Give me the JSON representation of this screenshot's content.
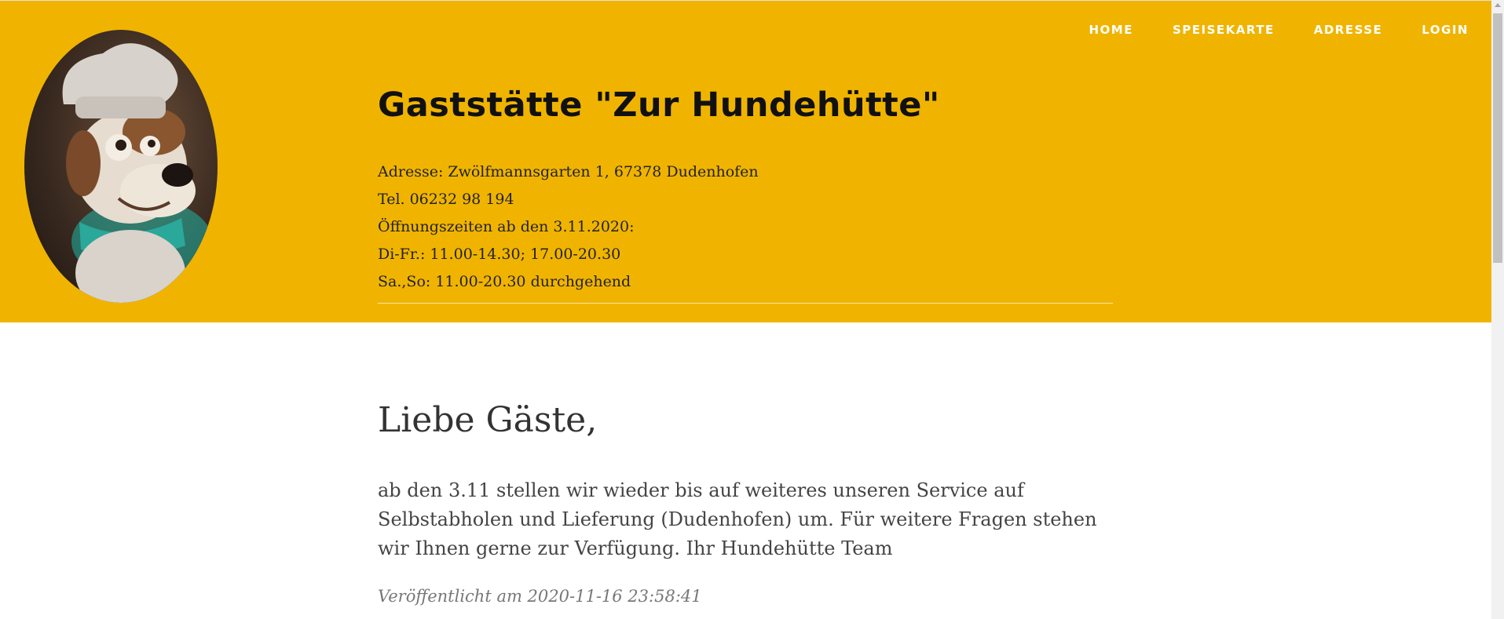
{
  "nav": {
    "items": [
      {
        "label": "HOME"
      },
      {
        "label": "SPEISEKARTE"
      },
      {
        "label": "ADRESSE"
      },
      {
        "label": "LOGIN"
      }
    ]
  },
  "header": {
    "title": "Gaststätte \"Zur Hundehütte\"",
    "address": "Adresse: Zwölfmannsgarten 1, 67378 Dudenhofen",
    "phone": "Tel. 06232 98 194",
    "hours_heading": "Öffnungszeiten ab den 3.11.2020:",
    "hours_weekdays": "Di-Fr.: 11.00-14.30; 17.00-20.30",
    "hours_weekend": "Sa.,So: 11.00-20.30 durchgehend",
    "logo_icon": "chef-dog-logo",
    "background_color": "#f0b400"
  },
  "post": {
    "title": "Liebe Gäste,",
    "body": "ab den 3.11 stellen wir wieder bis auf weiteres unseren Service auf Selbstabholen und Lieferung (Dudenhofen) um. Für weitere Fragen stehen wir Ihnen gerne zur Verfügung. Ihr Hundehütte Team",
    "published": "Veröffentlicht am 2020-11-16 23:58:41"
  }
}
